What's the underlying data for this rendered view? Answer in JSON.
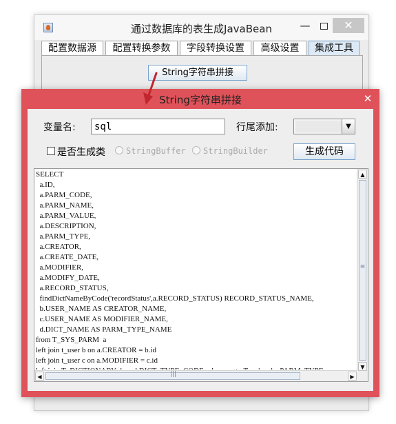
{
  "main_window": {
    "title": "通过数据库的表生成JavaBean",
    "minimize_label": "—",
    "close_label": "✕",
    "tabs": [
      {
        "label": "配置数据源"
      },
      {
        "label": "配置转换参数"
      },
      {
        "label": "字段转换设置"
      },
      {
        "label": "高级设置"
      },
      {
        "label": "集成工具"
      }
    ],
    "active_tab": "集成工具",
    "string_join_button": "String字符串拼接"
  },
  "dialog": {
    "title": "String字符串拼接",
    "close_label": "✕",
    "variable_label": "变量名:",
    "variable_value": "sql",
    "suffix_label": "行尾添加:",
    "suffix_value": "",
    "generate_class_label": "是否生成类",
    "generate_class_checked": false,
    "radio_stringbuffer": "StringBuffer",
    "radio_stringbuilder": "StringBuilder",
    "generate_button": "生成代码",
    "code": "SELECT\n  a.ID,\n  a.PARM_CODE,\n  a.PARM_NAME,\n  a.PARM_VALUE,\n  a.DESCRIPTION,\n  a.PARM_TYPE,\n  a.CREATOR,\n  a.CREATE_DATE,\n  a.MODIFIER,\n  a.MODIFY_DATE,\n  a.RECORD_STATUS,\n  findDictNameByCode('recordStatus',a.RECORD_STATUS) RECORD_STATUS_NAME,\n  b.USER_NAME AS CREATOR_NAME,\n  c.USER_NAME AS MODIFIER_NAME,\n  d.DICT_NAME AS PARM_TYPE_NAME\nfrom T_SYS_PARM  a\nleft join t_user b on a.CREATOR = b.id\nleft join t_user c on a.MODIFIER = c.id\nleft join T_DICTIONARY d on d.DICT_TYPE_CODE = 'parameterType' and a.PARM_TYPE"
  },
  "colors": {
    "dialog_frame": "#e0525a",
    "active_tab": "#ddeaf6",
    "arrow": "#c0262d"
  }
}
